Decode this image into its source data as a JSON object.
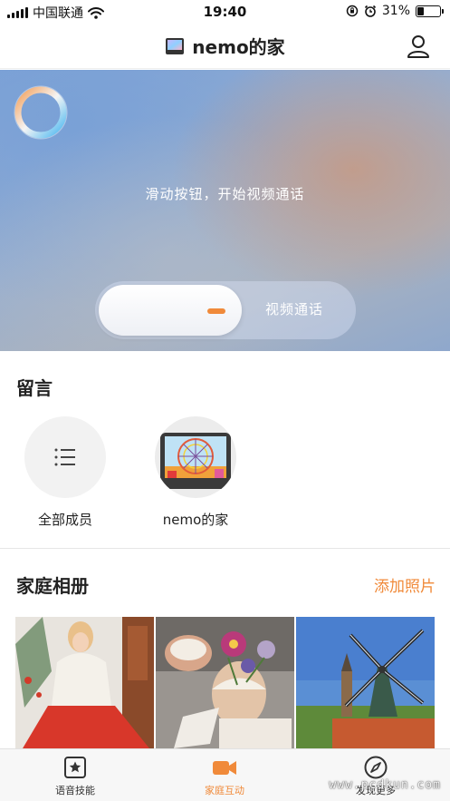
{
  "status_bar": {
    "carrier": "中国联通",
    "time": "19:40",
    "battery": "31%",
    "battery_level": 0.31
  },
  "nav": {
    "title": "nemo的家",
    "device_icon": "tv-screen-icon",
    "profile_icon": "user-profile-icon"
  },
  "hero": {
    "hint": "滑动按钮，开始视频通话",
    "slider_label": "视频通话",
    "logo_icon": "app-logo-ring-icon"
  },
  "messages": {
    "title": "留言",
    "contacts": [
      {
        "name": "全部成员",
        "icon": "list-icon"
      },
      {
        "name": "nemo的家",
        "icon": "device-photo-frame-icon"
      }
    ]
  },
  "album": {
    "title": "家庭相册",
    "add_label": "添加照片",
    "photos": [
      "woman-red-skirt",
      "eggshell-flowers",
      "windmill-village"
    ]
  },
  "tab_bar": {
    "tabs": [
      {
        "label": "语音技能",
        "icon": "star-box-icon",
        "active": false
      },
      {
        "label": "家庭互动",
        "icon": "video-camera-icon",
        "active": true
      },
      {
        "label": "发现更多",
        "icon": "compass-icon",
        "active": false
      }
    ]
  },
  "watermark": "www.pcdkun.com",
  "colors": {
    "accent": "#f08a3a",
    "text": "#222222",
    "hero_blue": "#7ea2d6"
  }
}
